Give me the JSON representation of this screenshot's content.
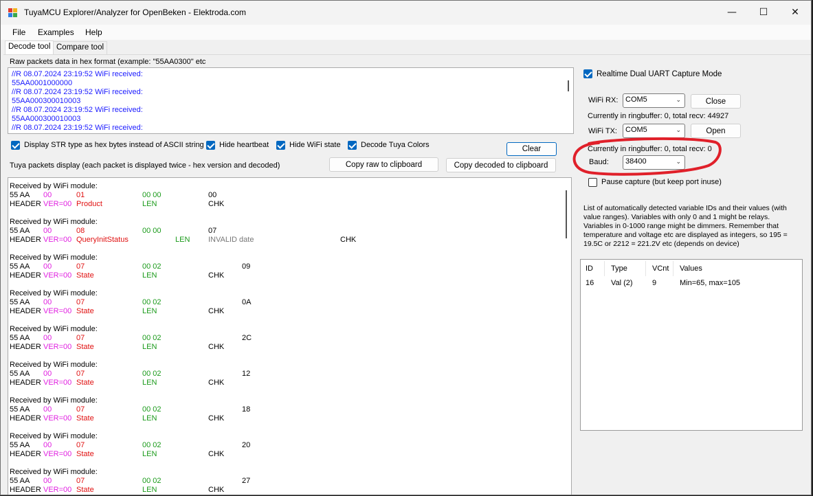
{
  "window": {
    "title": "TuyaMCU Explorer/Analyzer for OpenBeken - Elektroda.com",
    "controls": {
      "minimize": "—",
      "maximize": "☐",
      "close": "✕"
    }
  },
  "menu": {
    "file": "File",
    "examples": "Examples",
    "help": "Help"
  },
  "tabs": {
    "decode": "Decode tool",
    "compare": "Compare tool"
  },
  "raw": {
    "label": "Raw packets data in hex format (example: \"55AA0300\" etc",
    "lines": [
      "//R 08.07.2024 23:19:52 WiFi received:",
      "55AA0001000000",
      "//R 08.07.2024 23:19:52 WiFi received:",
      "55AA000300010003",
      "//R 08.07.2024 23:19:52 WiFi received:",
      "55AA000300010003",
      "//R 08.07.2024 23:19:52 WiFi received:"
    ]
  },
  "options": {
    "display_str_hex": "Display STR type as hex bytes instead of ASCII string",
    "hide_heartbeat": "Hide heartbeat",
    "hide_wifi_state": "Hide WiFi state",
    "decode_colors": "Decode Tuya Colors",
    "clear": "Clear"
  },
  "display": {
    "label": "Tuya packets display (each packet is displayed twice - hex version and decoded)",
    "copy_raw": "Copy raw to clipboard",
    "copy_decoded": "Copy decoded to clipboard"
  },
  "packets": [
    {
      "head": "Received by WiFi module:",
      "h1": "55 AA",
      "h2": "00",
      "h3": "01",
      "h4": "00 00",
      "h5": "00",
      "h6": "",
      "d1": "HEADER",
      "d2": "VER=00",
      "d3": "Product",
      "d4": "LEN",
      "d5": "CHK",
      "d6": "",
      "d7": ""
    },
    {
      "head": "Received by WiFi module:",
      "h1": "55 AA",
      "h2": "00",
      "h3": "08",
      "h4": "00 00",
      "h5": "07",
      "h6": "",
      "d1": "HEADER",
      "d2": "VER=00",
      "d3": "QueryInitStatus",
      "d4": "LEN",
      "d5": "INVALID date",
      "d6": "",
      "d7": "CHK"
    },
    {
      "head": "Received by WiFi module:",
      "h1": "55 AA",
      "h2": "00",
      "h3": "07",
      "h4": "00 02",
      "h5": "",
      "h6": "09",
      "d1": "HEADER",
      "d2": "VER=00",
      "d3": "State",
      "d4": "LEN",
      "d5": "CHK",
      "d6": "",
      "d7": ""
    },
    {
      "head": "Received by WiFi module:",
      "h1": "55 AA",
      "h2": "00",
      "h3": "07",
      "h4": "00 02",
      "h5": "",
      "h6": "0A",
      "d1": "HEADER",
      "d2": "VER=00",
      "d3": "State",
      "d4": "LEN",
      "d5": "CHK",
      "d6": "",
      "d7": ""
    },
    {
      "head": "Received by WiFi module:",
      "h1": "55 AA",
      "h2": "00",
      "h3": "07",
      "h4": "00 02",
      "h5": "",
      "h6": "2C",
      "d1": "HEADER",
      "d2": "VER=00",
      "d3": "State",
      "d4": "LEN",
      "d5": "CHK",
      "d6": "",
      "d7": ""
    },
    {
      "head": "Received by WiFi module:",
      "h1": "55 AA",
      "h2": "00",
      "h3": "07",
      "h4": "00 02",
      "h5": "",
      "h6": "12",
      "d1": "HEADER",
      "d2": "VER=00",
      "d3": "State",
      "d4": "LEN",
      "d5": "CHK",
      "d6": "",
      "d7": ""
    },
    {
      "head": "Received by WiFi module:",
      "h1": "55 AA",
      "h2": "00",
      "h3": "07",
      "h4": "00 02",
      "h5": "",
      "h6": "18",
      "d1": "HEADER",
      "d2": "VER=00",
      "d3": "State",
      "d4": "LEN",
      "d5": "CHK",
      "d6": "",
      "d7": ""
    },
    {
      "head": "Received by WiFi module:",
      "h1": "55 AA",
      "h2": "00",
      "h3": "07",
      "h4": "00 02",
      "h5": "",
      "h6": "20",
      "d1": "HEADER",
      "d2": "VER=00",
      "d3": "State",
      "d4": "LEN",
      "d5": "CHK",
      "d6": "",
      "d7": ""
    },
    {
      "head": "Received by WiFi module:",
      "h1": "55 AA",
      "h2": "00",
      "h3": "07",
      "h4": "00 02",
      "h5": "",
      "h6": "27",
      "d1": "HEADER",
      "d2": "VER=00",
      "d3": "State",
      "d4": "LEN",
      "d5": "CHK",
      "d6": "",
      "d7": ""
    }
  ],
  "capture": {
    "realtime": "Realtime Dual UART Capture Mode",
    "wifi_rx_label": "WiFi RX:",
    "wifi_rx_port": "COM5",
    "close": "Close",
    "rx_status": "Currently in ringbuffer: 0, total recv: 44927",
    "wifi_tx_label": "WiFi TX:",
    "wifi_tx_port": "COM5",
    "open": "Open",
    "tx_status": "Currently in ringbuffer: 0, total recv: 0",
    "baud_label": "Baud:",
    "baud_value": "38400",
    "pause": "Pause capture (but keep port inuse)"
  },
  "variables": {
    "description": "List of automatically detected variable IDs  and their values (with value ranges). Variables with only 0 and 1 might be relays. Variables in 0-1000 range might be dimmers. Remember that temperature and voltage etc are displayed as integers, so 195 = 19.5C or 2212 = 221.2V etc (depends on device)",
    "columns": [
      "ID",
      "Type",
      "VCnt",
      "Values"
    ],
    "rows": [
      [
        "16",
        "Val (2)",
        "9",
        "Min=65, max=105"
      ]
    ]
  },
  "colors": {
    "accent": "#0067c0",
    "annotation": "#e0202a",
    "hex_text": "#1a1aff"
  }
}
